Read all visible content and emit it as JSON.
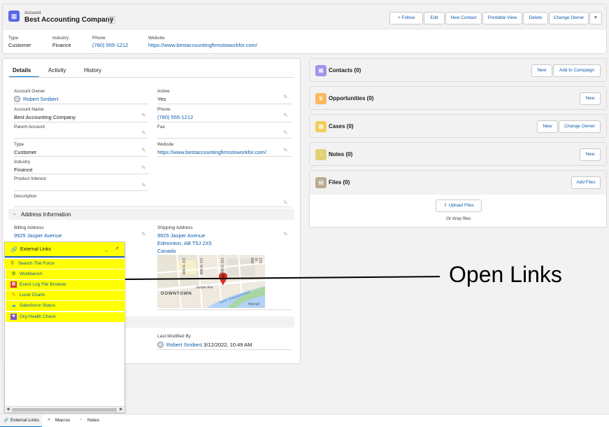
{
  "header": {
    "object_type": "Account",
    "title": "Best Accounting Company",
    "buttons": [
      "Follow",
      "Edit",
      "New Contact",
      "Printable View",
      "Delete",
      "Change Owner"
    ],
    "highlights": [
      {
        "label": "Type",
        "value": "Customer"
      },
      {
        "label": "Industry",
        "value": "Finance"
      },
      {
        "label": "Phone",
        "value": "(780) 555-1212"
      },
      {
        "label": "Website",
        "value": "https://www.bestaccountingfirmstoworkfor.com/"
      }
    ]
  },
  "tabs": [
    "Details",
    "Activity",
    "History"
  ],
  "details": {
    "account_owner_label": "Account Owner",
    "account_owner": "Robert Smibert",
    "active_label": "Active",
    "active": "Yes",
    "account_name_label": "Account Name",
    "account_name": "Best Accounting Company",
    "phone_label": "Phone",
    "phone": "(780) 555-1212",
    "parent_account_label": "Parent Account",
    "fax_label": "Fax",
    "type_label": "Type",
    "type": "Customer",
    "website_label": "Website",
    "website": "https://www.bestaccountingfirmstoworkfor.com/",
    "industry_label": "Industry",
    "industry": "Finance",
    "product_interest_label": "Product Interest",
    "description_label": "Description"
  },
  "address_section": {
    "title": "Address Information",
    "billing_label": "Billing Address",
    "billing_line1": "9925 Jasper Avenue",
    "shipping_label": "Shipping Address",
    "shipping_line1": "9925 Jasper Avenue",
    "shipping_line2": "Edmonton, AB T5J 2X5",
    "shipping_line3": "Canada"
  },
  "map": {
    "downtown": "DOWNTOWN",
    "street1": "Jasper Ave",
    "street2": "100 St NW",
    "street3": "101 St NW",
    "street4": "102 St NW",
    "street5": "103 St NW",
    "river": "North Saskatchewan",
    "henriet": "Henriet"
  },
  "system": {
    "last_modified_label": "Last Modified By",
    "last_modified_user": "Robert Smibert",
    "last_modified_date": ", 3/12/2022, 10:49 AM"
  },
  "related": {
    "contacts": {
      "title": "Contacts (0)",
      "buttons": [
        "New",
        "Add to Campaign"
      ],
      "color": "#a094ed"
    },
    "opportunities": {
      "title": "Opportunities (0)",
      "buttons": [
        "New"
      ],
      "color": "#fcb95b"
    },
    "cases": {
      "title": "Cases (0)",
      "buttons": [
        "New",
        "Change Owner"
      ],
      "color": "#f2cf5b"
    },
    "notes": {
      "title": "Notes (0)",
      "buttons": [
        "New"
      ],
      "color": "#e3d076"
    },
    "files": {
      "title": "Files (0)",
      "buttons": [
        "Add Files"
      ],
      "color": "#baac93",
      "upload_label": "Upload Files",
      "drop_label": "Or drop files"
    }
  },
  "external_links": {
    "title": "External Links",
    "items": [
      {
        "label": "Search The Force",
        "icon": "search-icon"
      },
      {
        "label": "Workbench",
        "icon": "workbench-icon"
      },
      {
        "label": "Event Log File Browser",
        "icon": "event-log-icon"
      },
      {
        "label": "Lucid Charts",
        "icon": "pencil-icon"
      },
      {
        "label": "Salesforce Status",
        "icon": "cloud-icon"
      },
      {
        "label": "Org Health Check",
        "icon": "health-icon"
      }
    ]
  },
  "annotation": {
    "text": "Open Links"
  },
  "utility_bar": [
    "External Links",
    "Macros",
    "Notes"
  ]
}
